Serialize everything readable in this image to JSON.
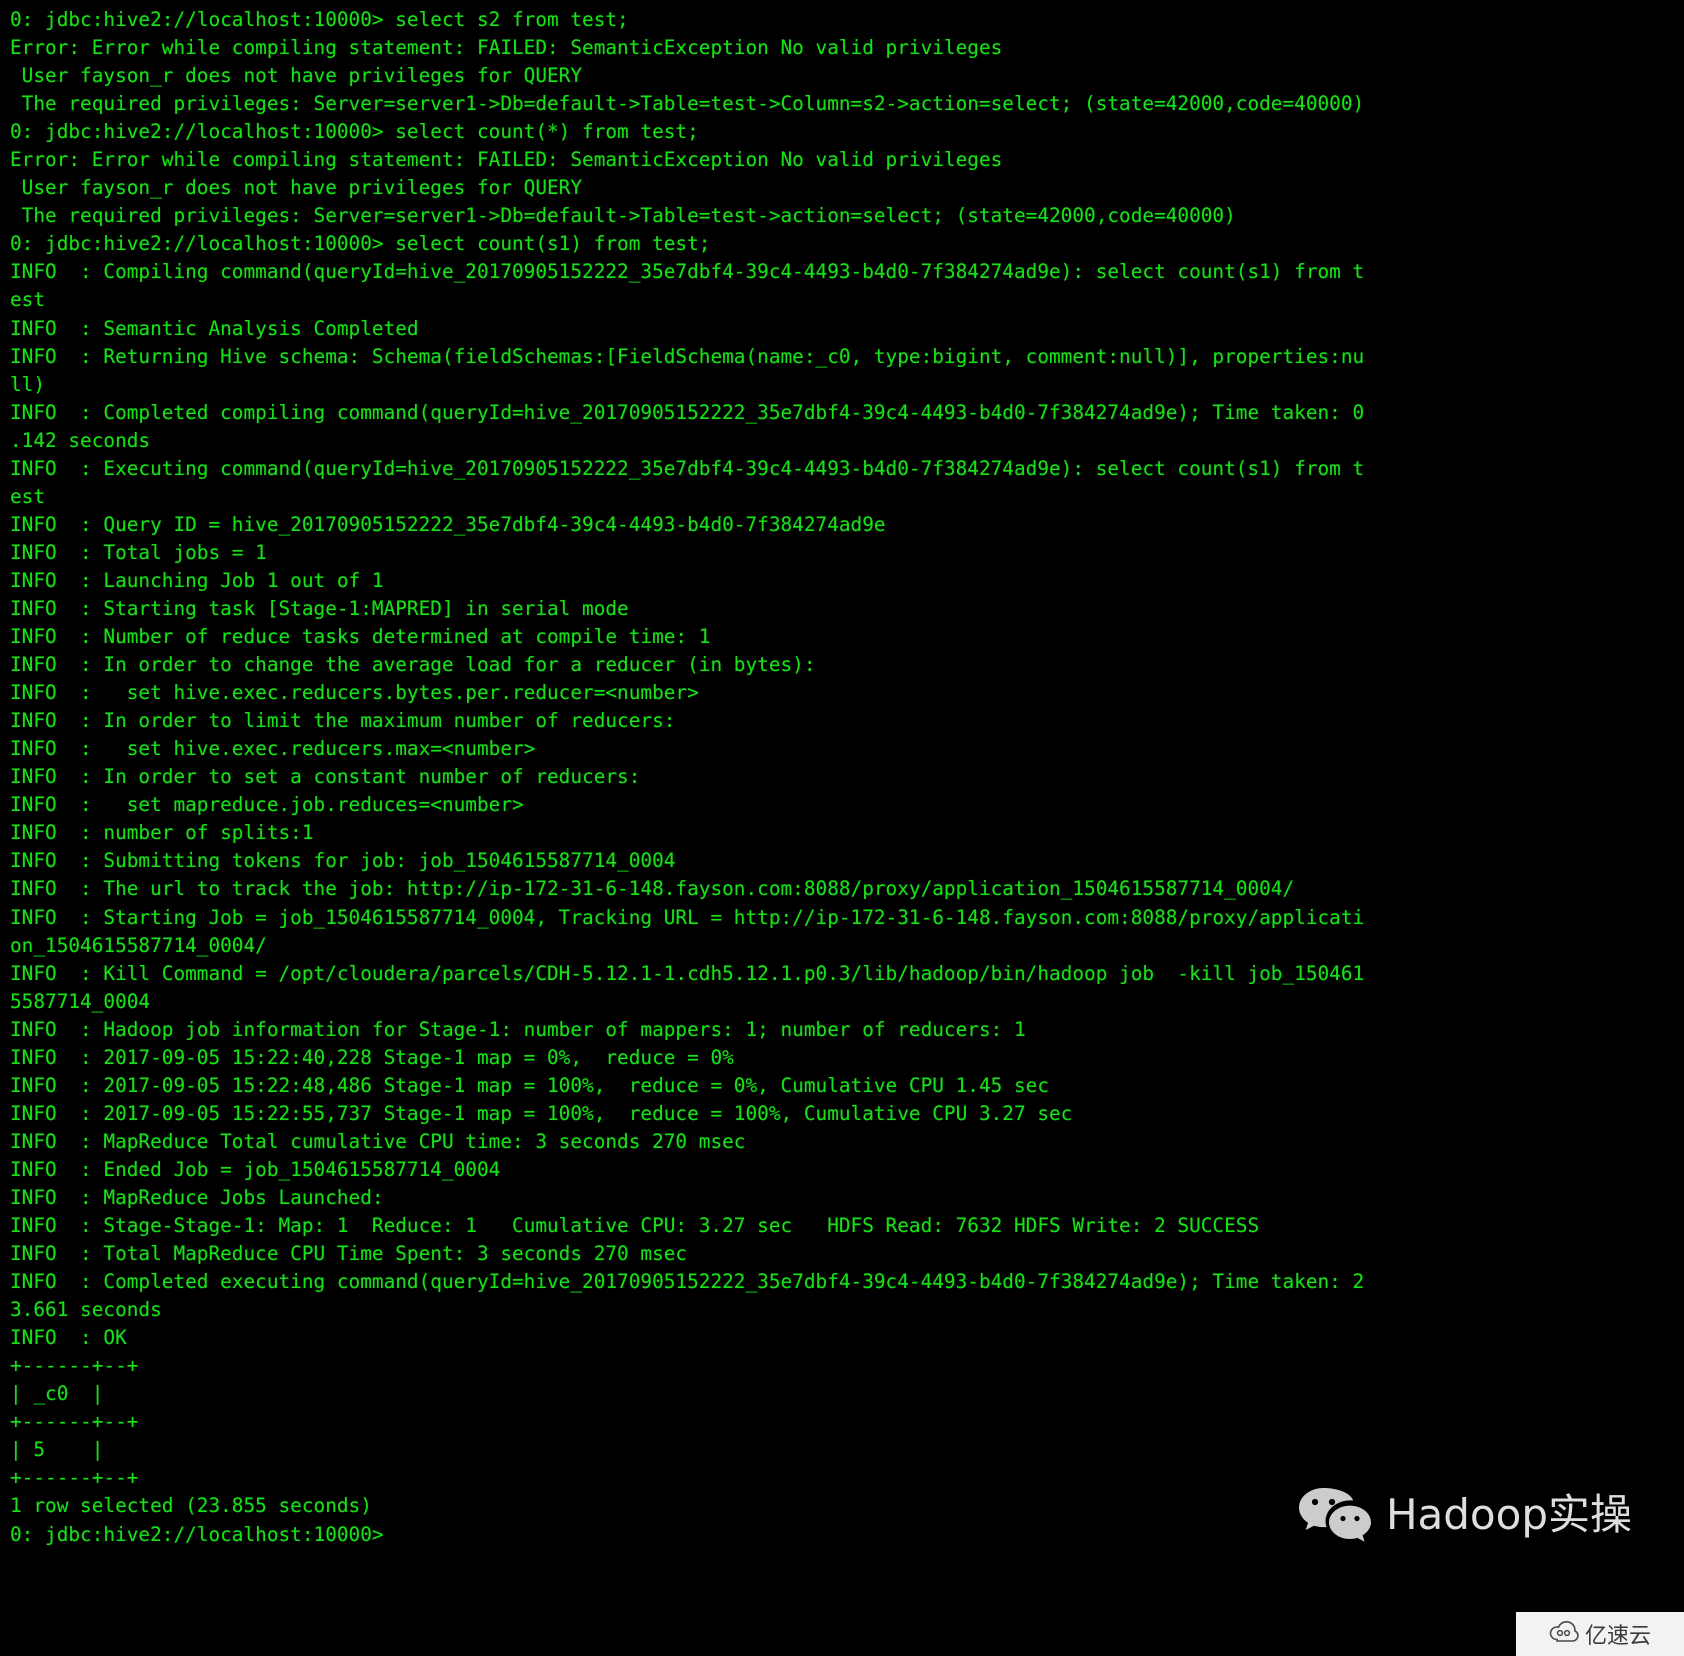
{
  "terminal": {
    "prompt": "0: jdbc:hive2://localhost:10000>",
    "foreground_color": "#18e018",
    "background_color": "#000000",
    "lines": [
      "0: jdbc:hive2://localhost:10000> select s2 from test;",
      "Error: Error while compiling statement: FAILED: SemanticException No valid privileges",
      " User fayson_r does not have privileges for QUERY",
      " The required privileges: Server=server1->Db=default->Table=test->Column=s2->action=select; (state=42000,code=40000)",
      "0: jdbc:hive2://localhost:10000> select count(*) from test;",
      "Error: Error while compiling statement: FAILED: SemanticException No valid privileges",
      " User fayson_r does not have privileges for QUERY",
      " The required privileges: Server=server1->Db=default->Table=test->action=select; (state=42000,code=40000)",
      "0: jdbc:hive2://localhost:10000> select count(s1) from test;",
      "INFO  : Compiling command(queryId=hive_20170905152222_35e7dbf4-39c4-4493-b4d0-7f384274ad9e): select count(s1) from t",
      "est",
      "INFO  : Semantic Analysis Completed",
      "INFO  : Returning Hive schema: Schema(fieldSchemas:[FieldSchema(name:_c0, type:bigint, comment:null)], properties:nu",
      "ll)",
      "INFO  : Completed compiling command(queryId=hive_20170905152222_35e7dbf4-39c4-4493-b4d0-7f384274ad9e); Time taken: 0",
      ".142 seconds",
      "INFO  : Executing command(queryId=hive_20170905152222_35e7dbf4-39c4-4493-b4d0-7f384274ad9e): select count(s1) from t",
      "est",
      "INFO  : Query ID = hive_20170905152222_35e7dbf4-39c4-4493-b4d0-7f384274ad9e",
      "INFO  : Total jobs = 1",
      "INFO  : Launching Job 1 out of 1",
      "INFO  : Starting task [Stage-1:MAPRED] in serial mode",
      "INFO  : Number of reduce tasks determined at compile time: 1",
      "INFO  : In order to change the average load for a reducer (in bytes):",
      "INFO  :   set hive.exec.reducers.bytes.per.reducer=<number>",
      "INFO  : In order to limit the maximum number of reducers:",
      "INFO  :   set hive.exec.reducers.max=<number>",
      "INFO  : In order to set a constant number of reducers:",
      "INFO  :   set mapreduce.job.reduces=<number>",
      "INFO  : number of splits:1",
      "INFO  : Submitting tokens for job: job_1504615587714_0004",
      "INFO  : The url to track the job: http://ip-172-31-6-148.fayson.com:8088/proxy/application_1504615587714_0004/",
      "INFO  : Starting Job = job_1504615587714_0004, Tracking URL = http://ip-172-31-6-148.fayson.com:8088/proxy/applicati",
      "on_1504615587714_0004/",
      "INFO  : Kill Command = /opt/cloudera/parcels/CDH-5.12.1-1.cdh5.12.1.p0.3/lib/hadoop/bin/hadoop job  -kill job_150461",
      "5587714_0004",
      "INFO  : Hadoop job information for Stage-1: number of mappers: 1; number of reducers: 1",
      "INFO  : 2017-09-05 15:22:40,228 Stage-1 map = 0%,  reduce = 0%",
      "INFO  : 2017-09-05 15:22:48,486 Stage-1 map = 100%,  reduce = 0%, Cumulative CPU 1.45 sec",
      "INFO  : 2017-09-05 15:22:55,737 Stage-1 map = 100%,  reduce = 100%, Cumulative CPU 3.27 sec",
      "INFO  : MapReduce Total cumulative CPU time: 3 seconds 270 msec",
      "INFO  : Ended Job = job_1504615587714_0004",
      "INFO  : MapReduce Jobs Launched:",
      "INFO  : Stage-Stage-1: Map: 1  Reduce: 1   Cumulative CPU: 3.27 sec   HDFS Read: 7632 HDFS Write: 2 SUCCESS",
      "INFO  : Total MapReduce CPU Time Spent: 3 seconds 270 msec",
      "INFO  : Completed executing command(queryId=hive_20170905152222_35e7dbf4-39c4-4493-b4d0-7f384274ad9e); Time taken: 2",
      "3.661 seconds",
      "INFO  : OK",
      "+------+--+",
      "| _c0  |",
      "+------+--+",
      "| 5    |",
      "+------+--+",
      "1 row selected (23.855 seconds)",
      "0: jdbc:hive2://localhost:10000>"
    ],
    "result_table": {
      "columns": [
        "_c0"
      ],
      "rows": [
        [
          "5"
        ]
      ],
      "footer": "1 row selected (23.855 seconds)"
    }
  },
  "watermark": {
    "icon": "wechat-icon",
    "text": "Hadoop实操"
  },
  "corner_badge": {
    "icon": "cloud-icon",
    "text": "亿速云"
  }
}
